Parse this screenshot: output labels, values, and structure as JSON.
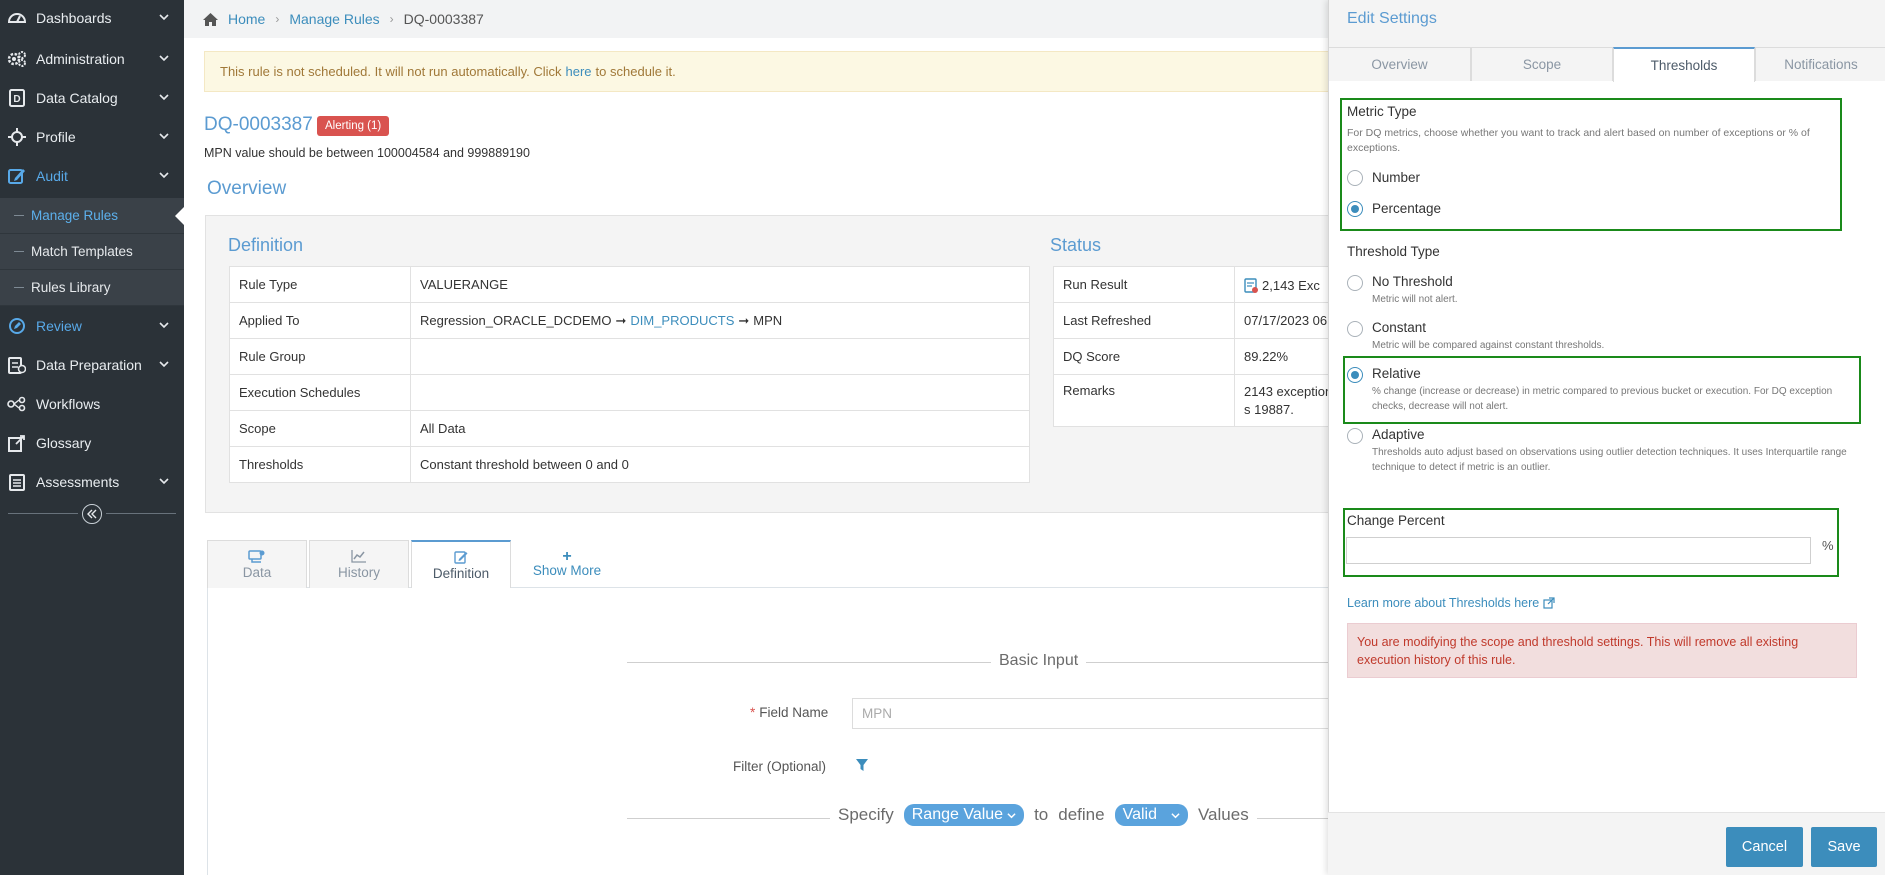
{
  "sidebar": {
    "items": [
      {
        "label": "Dashboards",
        "icon": "dashboard-icon"
      },
      {
        "label": "Administration",
        "icon": "gears-icon"
      },
      {
        "label": "Data Catalog",
        "icon": "catalog-icon"
      },
      {
        "label": "Profile",
        "icon": "profile-icon"
      },
      {
        "label": "Audit",
        "icon": "edit-icon"
      },
      {
        "label": "Review",
        "icon": "review-icon"
      },
      {
        "label": "Data Preparation",
        "icon": "data-prep-icon"
      },
      {
        "label": "Workflows",
        "icon": "workflows-icon"
      },
      {
        "label": "Glossary",
        "icon": "glossary-icon"
      },
      {
        "label": "Assessments",
        "icon": "assessments-icon"
      }
    ],
    "audit_sub": [
      "Manage Rules",
      "Match Templates",
      "Rules Library"
    ]
  },
  "breadcrumb": {
    "home": "Home",
    "manage_rules": "Manage Rules",
    "current": "DQ-0003387"
  },
  "notice": {
    "before": "This rule is not scheduled. It will not run automatically. Click",
    "link": "here",
    "after": "to schedule it."
  },
  "rule": {
    "id": "DQ-0003387",
    "badge": "Alerting (1)",
    "description": "MPN value should be between 100004584 and 999889190"
  },
  "overview_title": "Overview",
  "definition": {
    "title": "Definition",
    "rows": [
      {
        "key": "Rule Type",
        "value": "VALUERANGE"
      },
      {
        "key": "Applied To",
        "value": ""
      },
      {
        "key": "Rule Group",
        "value": ""
      },
      {
        "key": "Execution Schedules",
        "value": ""
      },
      {
        "key": "Scope",
        "value": "All Data"
      },
      {
        "key": "Thresholds",
        "value": "Constant threshold between 0 and 0"
      }
    ],
    "applied_to": {
      "source": "Regression_ORACLE_DCDEMO",
      "table": "DIM_PRODUCTS",
      "column": "MPN",
      "arrow": "➞"
    }
  },
  "status": {
    "title": "Status",
    "rows": [
      {
        "key": "Run Result",
        "value": "2,143 Exc"
      },
      {
        "key": "Last Refreshed",
        "value": "07/17/2023 06"
      },
      {
        "key": "DQ Score",
        "value": "89.22%"
      },
      {
        "key": "Remarks",
        "value": "2143 exceptions 19887."
      }
    ],
    "remarks_line1": "2143 exception",
    "remarks_line2": "s 19887."
  },
  "tabs": {
    "data": "Data",
    "history": "History",
    "definition": "Definition",
    "show_more": "Show More"
  },
  "basic_input": {
    "title": "Basic Input",
    "field_name_label": "Field Name",
    "field_name_value": "MPN",
    "filter_label": "Filter (Optional)",
    "specify": "Specify",
    "range_value": "Range Value",
    "to_define": "to",
    "define": "define",
    "valid": "Valid",
    "values": "Values"
  },
  "panel": {
    "title": "Edit Settings",
    "tabs": [
      "Overview",
      "Scope",
      "Thresholds",
      "Notifications"
    ],
    "active_tab": "Thresholds",
    "metric_type": {
      "label": "Metric Type",
      "help": "For DQ metrics, choose whether you want to track and alert based on number of exceptions or % of exceptions.",
      "options": [
        "Number",
        "Percentage"
      ],
      "selected": "Percentage"
    },
    "threshold_type": {
      "label": "Threshold Type",
      "options": [
        {
          "label": "No Threshold",
          "help": "Metric will not alert."
        },
        {
          "label": "Constant",
          "help": "Metric will be compared against constant thresholds."
        },
        {
          "label": "Relative",
          "help": "% change (increase or decrease) in metric compared to previous bucket or execution. For DQ exception checks, decrease will not alert."
        },
        {
          "label": "Adaptive",
          "help": "Thresholds auto adjust based on observations using outlier detection techniques. It uses Interquartile range technique to detect if metric is an outlier."
        }
      ],
      "selected": "Relative"
    },
    "change_percent": {
      "label": "Change Percent",
      "value": "",
      "unit": "%"
    },
    "learn_more": "Learn more about Thresholds here",
    "warning": "You are modifying the scope and threshold settings. This will remove all existing execution history of this rule.",
    "cancel": "Cancel",
    "save": "Save"
  },
  "colors": {
    "accent": "#3c8dbc",
    "sidebar_bg": "#2b3238",
    "highlight_box": "#1a8a1a",
    "badge": "#d9534f"
  }
}
